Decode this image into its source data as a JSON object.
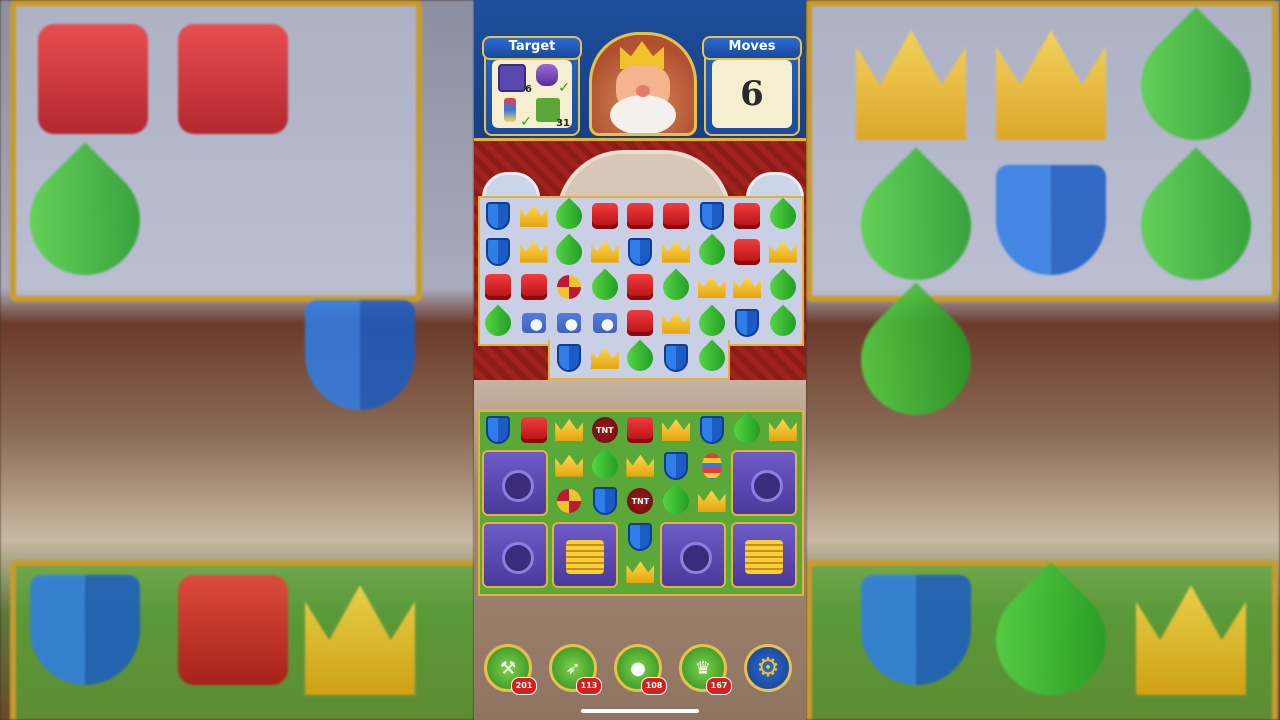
{
  "header": {
    "target_label": "Target",
    "moves_label": "Moves",
    "moves_value": "6",
    "targets": [
      {
        "icon": "safe-icon",
        "count": "6"
      },
      {
        "icon": "vase-icon",
        "count": "",
        "done": "✓"
      },
      {
        "icon": "firework-icon",
        "count": "",
        "done": "✓"
      },
      {
        "icon": "grass-icon",
        "count": "31"
      }
    ]
  },
  "boosters": [
    {
      "icon": "hammer-icon",
      "count": "201"
    },
    {
      "icon": "arrow-icon",
      "count": "113"
    },
    {
      "icon": "cannon-icon",
      "count": "108"
    },
    {
      "icon": "jester-hat-icon",
      "count": "167"
    }
  ],
  "settings_icon": "gear-icon",
  "tnt_label": "TNT",
  "colors": {
    "header_blue": "#1d4f9c",
    "gold": "#e8c14a",
    "wall_red": "#a0231d",
    "grass": "#5aa838"
  },
  "board1": [
    [
      "blue",
      "crown",
      "green",
      "red",
      "red",
      "red",
      "blue",
      "red",
      "green"
    ],
    [
      "blue",
      "crown",
      "green",
      "crown",
      "blue",
      "crown",
      "green",
      "red",
      "crown"
    ],
    [
      "red",
      "red",
      "prop",
      "green",
      "red",
      "green",
      "crown",
      "crown",
      "green"
    ],
    [
      "green",
      "ice",
      "ice",
      "ice",
      "red",
      "crown",
      "green",
      "blue",
      "green"
    ],
    [
      "",
      "",
      "blue",
      "crown",
      "green",
      "blue",
      "green",
      "",
      ""
    ]
  ],
  "board2": [
    [
      "blue",
      "red",
      "crown",
      "tnt",
      "red",
      "crown",
      "blue",
      "green",
      "crown"
    ],
    [
      "",
      "",
      "crown",
      "green",
      "crown",
      "blue",
      "egg",
      "",
      ""
    ],
    [
      "",
      "",
      "prop",
      "blue",
      "tnt",
      "green",
      "crown",
      "",
      ""
    ],
    [
      "",
      "",
      "",
      "",
      "blue",
      "",
      "",
      "",
      ""
    ],
    [
      "",
      "",
      "",
      "",
      "crown",
      "",
      "",
      "",
      ""
    ]
  ]
}
